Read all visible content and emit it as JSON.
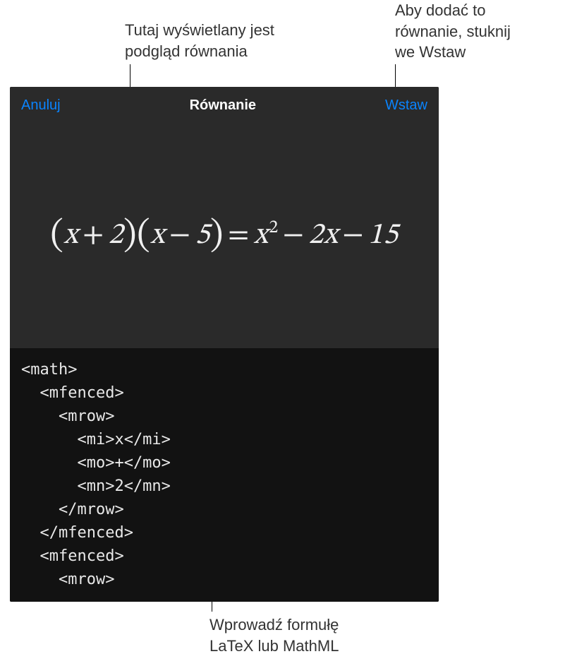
{
  "annotations": {
    "preview": "Tutaj wyświetlany jest\npodgląd równania",
    "insert": "Aby dodać to\nrównanie, stuknij\nwe Wstaw",
    "input": "Wprowadź formułę\nLaTeX lub MathML"
  },
  "header": {
    "cancel": "Anuluj",
    "title": "Równanie",
    "insert": "Wstaw"
  },
  "equation": {
    "x": "x",
    "plus": "+",
    "minus": "−",
    "eq": "=",
    "n2": "2",
    "n5": "5",
    "n15": "15",
    "sup2": "2"
  },
  "code": "<math>\n  <mfenced>\n    <mrow>\n      <mi>x</mi>\n      <mo>+</mo>\n      <mn>2</mn>\n    </mrow>\n  </mfenced>\n  <mfenced>\n    <mrow>"
}
